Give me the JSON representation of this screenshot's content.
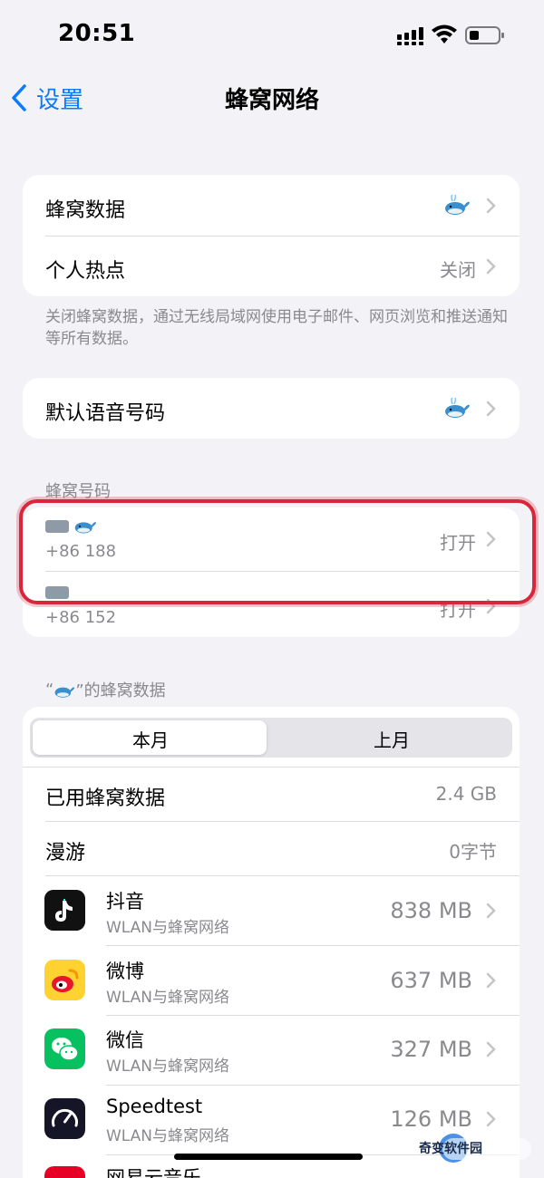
{
  "status_bar": {
    "time": "20:51"
  },
  "nav": {
    "back_label": "设置",
    "title": "蜂窝网络"
  },
  "group1": {
    "rows": [
      {
        "label": "蜂窝数据",
        "value_icon": "whale-emoji"
      },
      {
        "label": "个人热点",
        "value": "关闭"
      }
    ],
    "footer": "关闭蜂窝数据，通过无线局域网使用电子邮件、网页浏览和推送通知等所有数据。"
  },
  "group2": {
    "rows": [
      {
        "label": "默认语音号码",
        "value_icon": "whale-emoji"
      }
    ]
  },
  "cellular_numbers": {
    "header": "蜂窝号码",
    "lines": [
      {
        "number": "+86 188",
        "status": "打开"
      },
      {
        "number": "+86 152",
        "status": "打开"
      }
    ]
  },
  "usage": {
    "header_prefix": "“",
    "header_suffix": "”的蜂窝数据",
    "tabs": [
      "本月",
      "上月"
    ],
    "selected_tab": "本月",
    "summary": [
      {
        "label": "已用蜂窝数据",
        "value": "2.4 GB"
      },
      {
        "label": "漫游",
        "value": "0字节"
      }
    ],
    "apps": [
      {
        "name": "抖音",
        "subtitle": "WLAN与蜂窝网络",
        "value": "838 MB",
        "icon": "douyin-icon"
      },
      {
        "name": "微博",
        "subtitle": "WLAN与蜂窝网络",
        "value": "637 MB",
        "icon": "weibo-icon"
      },
      {
        "name": "微信",
        "subtitle": "WLAN与蜂窝网络",
        "value": "327 MB",
        "icon": "wechat-icon"
      },
      {
        "name": "Speedtest",
        "subtitle": "WLAN与蜂窝网络",
        "value": "126 MB",
        "icon": "speedtest-icon"
      },
      {
        "name": "网易云音乐",
        "subtitle": "",
        "value": "",
        "icon": "netease-music-icon"
      }
    ]
  },
  "watermark": {
    "text": "奇变软件园"
  },
  "colors": {
    "accent": "#0a7aff",
    "highlight": "#d9263a",
    "background": "#f2f2f7"
  }
}
